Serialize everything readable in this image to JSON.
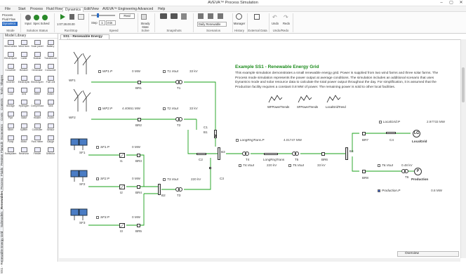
{
  "app": {
    "title": "AVEVA™ Process Simulation"
  },
  "menu": [
    "File",
    "Start",
    "Process",
    "Fluid Flow",
    "Dynamics",
    "Edit/View",
    "AVEVA™ Engineering",
    "Advanced",
    "Help"
  ],
  "ribbon": {
    "mode": {
      "label": "Mode",
      "items": [
        "Process",
        "Fluid Flow",
        "Dynamics"
      ]
    },
    "solution_status": {
      "label": "Solution Status",
      "items": [
        "Input",
        "Spec",
        "Solved"
      ]
    },
    "run_stop": {
      "label": "Run/Stop",
      "time": "1:07:28.00.00"
    },
    "speed": {
      "label": "Speed",
      "step": "Step",
      "step_value": "1",
      "step_unit": "min",
      "real": "Real"
    },
    "solve": {
      "label": "Solve",
      "steady": "Steady State"
    },
    "snapshots": {
      "label": "Snapshots"
    },
    "scenarios": {
      "label": "Scenarios",
      "value": "Daily Renewable"
    },
    "history": {
      "label": "History",
      "manager": "Manager"
    },
    "external": {
      "label": "External Data"
    },
    "undo_redo": {
      "label": "Undo/Redo",
      "undo": "Undo",
      "redo": "Redo"
    }
  },
  "side_tabs": [
    "Shapes",
    "Tools",
    "Controls",
    "Costs",
    "Economics",
    "FlamLib",
    "Preview",
    "Fluids",
    "Process",
    "Renewables",
    "Submodels",
    "SS1 - Renewable Energy Grid"
  ],
  "library": {
    "title": "Model Library",
    "items": [
      "Wind turbine",
      "Wind farm",
      "Solar panel",
      "Battery",
      "Electrolyzer",
      "Cable",
      "Busbar",
      "Transformer",
      "Converter",
      "Breaker",
      "Generator",
      "Consumer",
      "Inverter",
      "Electrolytic",
      "Electrolyzer",
      "Fuel cell",
      "Load",
      "Grid",
      "Meter",
      "Switch",
      "Storage",
      "Hydrogen",
      "Compressor",
      "Tank",
      "Pipe",
      "Valve",
      "Heater",
      "Cooler",
      "Mixer",
      "Splitter",
      "Controller",
      "Sensor",
      "Pump",
      "Motor",
      "Flow meter",
      "Gauge",
      "Subsystem",
      "Reservoir",
      "Feeder",
      "Selector"
    ]
  },
  "doc_tab": "SS1 - Renewable Energy Grid",
  "overview": "Overview",
  "info": {
    "heading": "Example SS1 - Renewable Energy Grid",
    "body": "This example simulation demonstrates a small renewable energy grid. Power is supplied from two wind farms and three solar farms. The Process mode simulation represents the power output at average conditions. The simulation includes an additional scenario that uses Dynamics mode and solar resource data to calculate the total power output throughout the day. For simplification, it is assumed that the Production facility requires a constant 0.8 MW of power. The remaining power is sold to other local facilities."
  },
  "trends": [
    "WFPowerTrends",
    "SFPowerTrends",
    "LocalGridTrend"
  ],
  "diagram": {
    "colors": {
      "line": "#1aa01a",
      "text": "#333333",
      "value": "#444444"
    },
    "wind": [
      {
        "name": "WF1",
        "tag": "WF1.P",
        "power": "0 MW",
        "tvout": "T1.Vout",
        "volt": "33 kV",
        "br": "BR1",
        "t": "T1"
      },
      {
        "name": "WF2",
        "tag": "WF2.P",
        "power": "4.40651 MW",
        "tvout": "T2.Vout",
        "volt": "33 kV",
        "br": "BR2",
        "t": "T2"
      }
    ],
    "solar": [
      {
        "name": "SF1",
        "tag": "SF1.P",
        "power": "0 MW",
        "inv": "I1",
        "br": "BR3"
      },
      {
        "name": "SF2",
        "tag": "SF2.P",
        "power": "0 MW",
        "inv": "I2",
        "br": "BR4"
      },
      {
        "name": "SF3",
        "tag": "SF3.P",
        "power": "0 MW",
        "inv": "I3",
        "br": "BR5"
      }
    ],
    "t3": {
      "name": "T3",
      "tvout": "T3.Vout",
      "volt": "220 kV"
    },
    "b1": "B1",
    "b2": "B2",
    "b3": "B3",
    "b4": "B4",
    "cables": [
      "C1",
      "C2",
      "C3",
      "C4"
    ],
    "long_trans": {
      "tag": "LongRngTrans.P",
      "power": "4.01747 MW",
      "name": "LongRngTrans"
    },
    "t4": {
      "name": "T4",
      "tag": "T4.Vout",
      "volt": "220 kV"
    },
    "t5": {
      "name": "T5",
      "tag": "T5.Vout",
      "volt": "33 kV"
    },
    "br6": "BR6",
    "br7": "BR7",
    "br8": "BR8",
    "local": {
      "tag": "LocalGrid.P",
      "power": "2.97733 MW",
      "name": "LocalGrid",
      "sym": "LG"
    },
    "t6": {
      "name": "T6",
      "tag": "T6.Vout",
      "volt": "0.48 kV"
    },
    "production": {
      "tag": "Production.P",
      "power": "0.8 MW",
      "name": "Production",
      "sym": "P"
    }
  }
}
